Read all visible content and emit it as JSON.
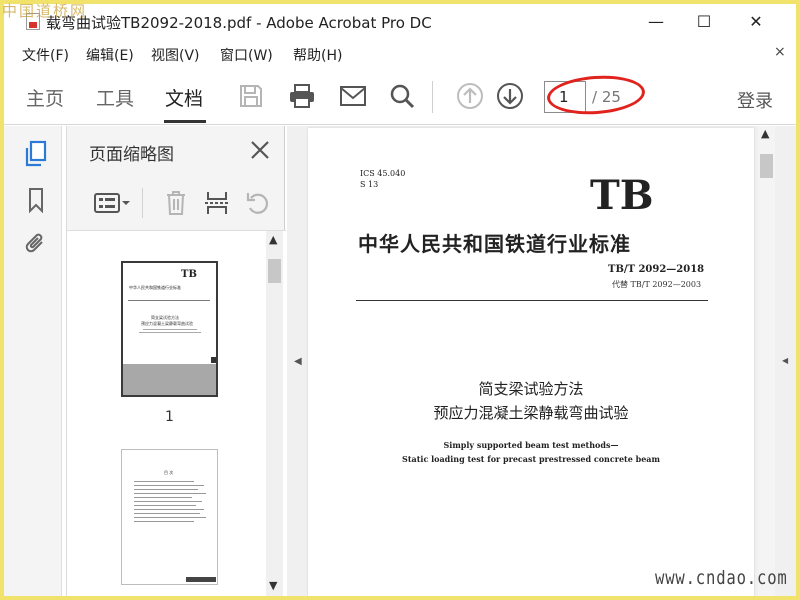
{
  "window": {
    "title": "载弯曲试验TB2092-2018.pdf - Adobe Acrobat Pro DC",
    "minimize_glyph": "—",
    "maximize_glyph": "☐",
    "close_glyph": "✕"
  },
  "watermarks": {
    "top_left": "中国道桥网",
    "bottom_right": "www.cndao.com"
  },
  "menu": {
    "items": [
      "文件(F)",
      "编辑(E)",
      "视图(V)",
      "窗口(W)",
      "帮助(H)"
    ],
    "close_glyph": "×"
  },
  "toolbar": {
    "tabs": [
      "主页",
      "工具",
      "文档"
    ],
    "active_tab": "文档",
    "icons": [
      "save-icon",
      "print-icon",
      "email-icon",
      "search-icon",
      "page-up-icon",
      "page-down-icon"
    ],
    "page_current": "1",
    "page_total": "/ 25",
    "login_label": "登录",
    "annotation_color": "#e0231d"
  },
  "left_rail": {
    "icons": [
      "page-thumbnails-icon",
      "bookmark-icon",
      "attachment-icon"
    ],
    "accent_color": "#2b7bd6"
  },
  "thumbnail_panel": {
    "title": "页面缩略图",
    "close_glyph": "×",
    "tools": [
      "options-menu-icon",
      "delete-icon",
      "extract-icon",
      "rotate-icon"
    ],
    "page_labels": [
      "1"
    ],
    "thumb1_lines": {
      "tb": "TB",
      "title": "中华人民共和国铁道行业标准",
      "subtitle1": "简支梁试验方法",
      "subtitle2": "预应力混凝土梁静载弯曲试验"
    },
    "thumb2_lines": {
      "heading": "目  次"
    }
  },
  "document": {
    "ics": "ICS 45.040",
    "classification": "S 13",
    "logo": "TB",
    "standard_title": "中华人民共和国铁道行业标准",
    "standard_number": "TB/T 2092—2018",
    "replaces": "代替 TB/T 2092—2003",
    "title_cn_1": "简支梁试验方法",
    "title_cn_2": "预应力混凝土梁静载弯曲试验",
    "title_en_1": "Simply supported beam test methods—",
    "title_en_2": "Static loading test for precast prestressed concrete beam"
  }
}
